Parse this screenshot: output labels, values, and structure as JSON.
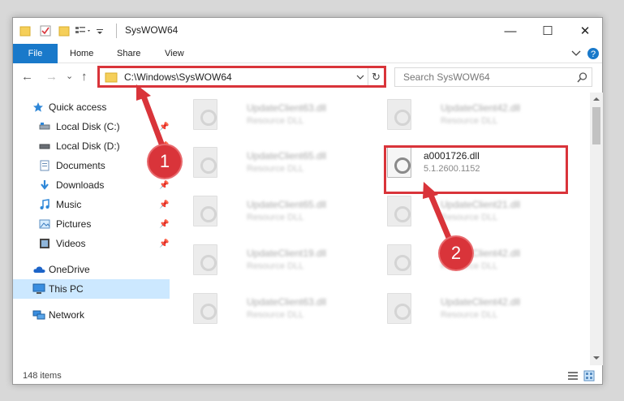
{
  "window": {
    "title": "SysWOW64",
    "controls": {
      "minimize": "—",
      "maximize": "☐",
      "close": "✕"
    }
  },
  "ribbon": {
    "tabs": [
      "File",
      "Home",
      "Share",
      "View"
    ],
    "expand_icon": "chevron-down-icon",
    "help_icon": "help-icon"
  },
  "navigation": {
    "back": "←",
    "forward": "→",
    "recent": "⌄",
    "up": "↑",
    "address": "C:\\Windows\\SysWOW64",
    "refresh": "↻",
    "search_placeholder": "Search SysWOW64"
  },
  "sidebar": {
    "items": [
      {
        "label": "Quick access",
        "icon": "star-icon",
        "pinned": false
      },
      {
        "label": "Local Disk (C:)",
        "icon": "drive-icon",
        "pinned": true
      },
      {
        "label": "Local Disk (D:)",
        "icon": "drive-icon",
        "pinned": true
      },
      {
        "label": "Documents",
        "icon": "document-icon",
        "pinned": true
      },
      {
        "label": "Downloads",
        "icon": "download-icon",
        "pinned": true
      },
      {
        "label": "Music",
        "icon": "music-icon",
        "pinned": true
      },
      {
        "label": "Pictures",
        "icon": "picture-icon",
        "pinned": true
      },
      {
        "label": "Videos",
        "icon": "video-icon",
        "pinned": true
      },
      {
        "label": "OneDrive",
        "icon": "cloud-icon",
        "pinned": false
      },
      {
        "label": "This PC",
        "icon": "computer-icon",
        "pinned": false,
        "selected": true
      },
      {
        "label": "Network",
        "icon": "network-icon",
        "pinned": false
      }
    ]
  },
  "files": [
    {
      "name": "UpdateClient63.dll",
      "desc": "Resource DLL"
    },
    {
      "name": "UpdateClient42.dll",
      "desc": "Resource DLL"
    },
    {
      "name": "UpdateClient65.dll",
      "desc": "Resource DLL"
    },
    {
      "name": "a0001726.dll",
      "desc": "5.1.2600.1152",
      "highlighted": true
    },
    {
      "name": "UpdateClient65.dll",
      "desc": "Resource DLL"
    },
    {
      "name": "UpdateClient21.dll",
      "desc": "Resource DLL"
    },
    {
      "name": "UpdateClient19.dll",
      "desc": "Resource DLL"
    },
    {
      "name": "UpdateClient42.dll",
      "desc": "Resource DLL"
    },
    {
      "name": "UpdateClient63.dll",
      "desc": "Resource DLL"
    },
    {
      "name": "UpdateClient42.dll",
      "desc": "Resource DLL"
    }
  ],
  "status": {
    "item_count": "148 items"
  },
  "annotations": {
    "step1": "1",
    "step2": "2",
    "color": "#d9343a"
  }
}
